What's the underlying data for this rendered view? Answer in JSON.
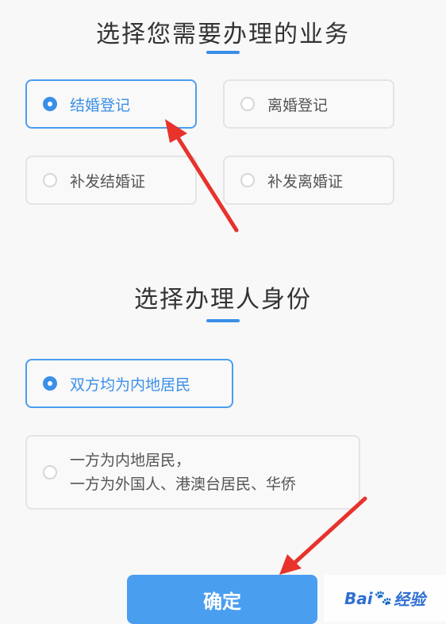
{
  "business_section": {
    "title": "选择您需要办理的业务",
    "options": [
      {
        "label": "结婚登记",
        "selected": true
      },
      {
        "label": "离婚登记",
        "selected": false
      },
      {
        "label": "补发结婚证",
        "selected": false
      },
      {
        "label": "补发离婚证",
        "selected": false
      }
    ]
  },
  "identity_section": {
    "title": "选择办理人身份",
    "options": [
      {
        "label": "双方均为内地居民",
        "selected": true
      },
      {
        "line1": "一方为内地居民，",
        "line2": "一方为外国人、港澳台居民、华侨",
        "selected": false
      }
    ]
  },
  "confirm_button": {
    "label": "确定"
  },
  "watermark": {
    "text_left": "Bai",
    "paw": "🐾",
    "text_right": "经验"
  },
  "colors": {
    "accent": "#3a8fe8",
    "button": "#4a9ef0",
    "annotation_arrow": "#e8322c"
  }
}
